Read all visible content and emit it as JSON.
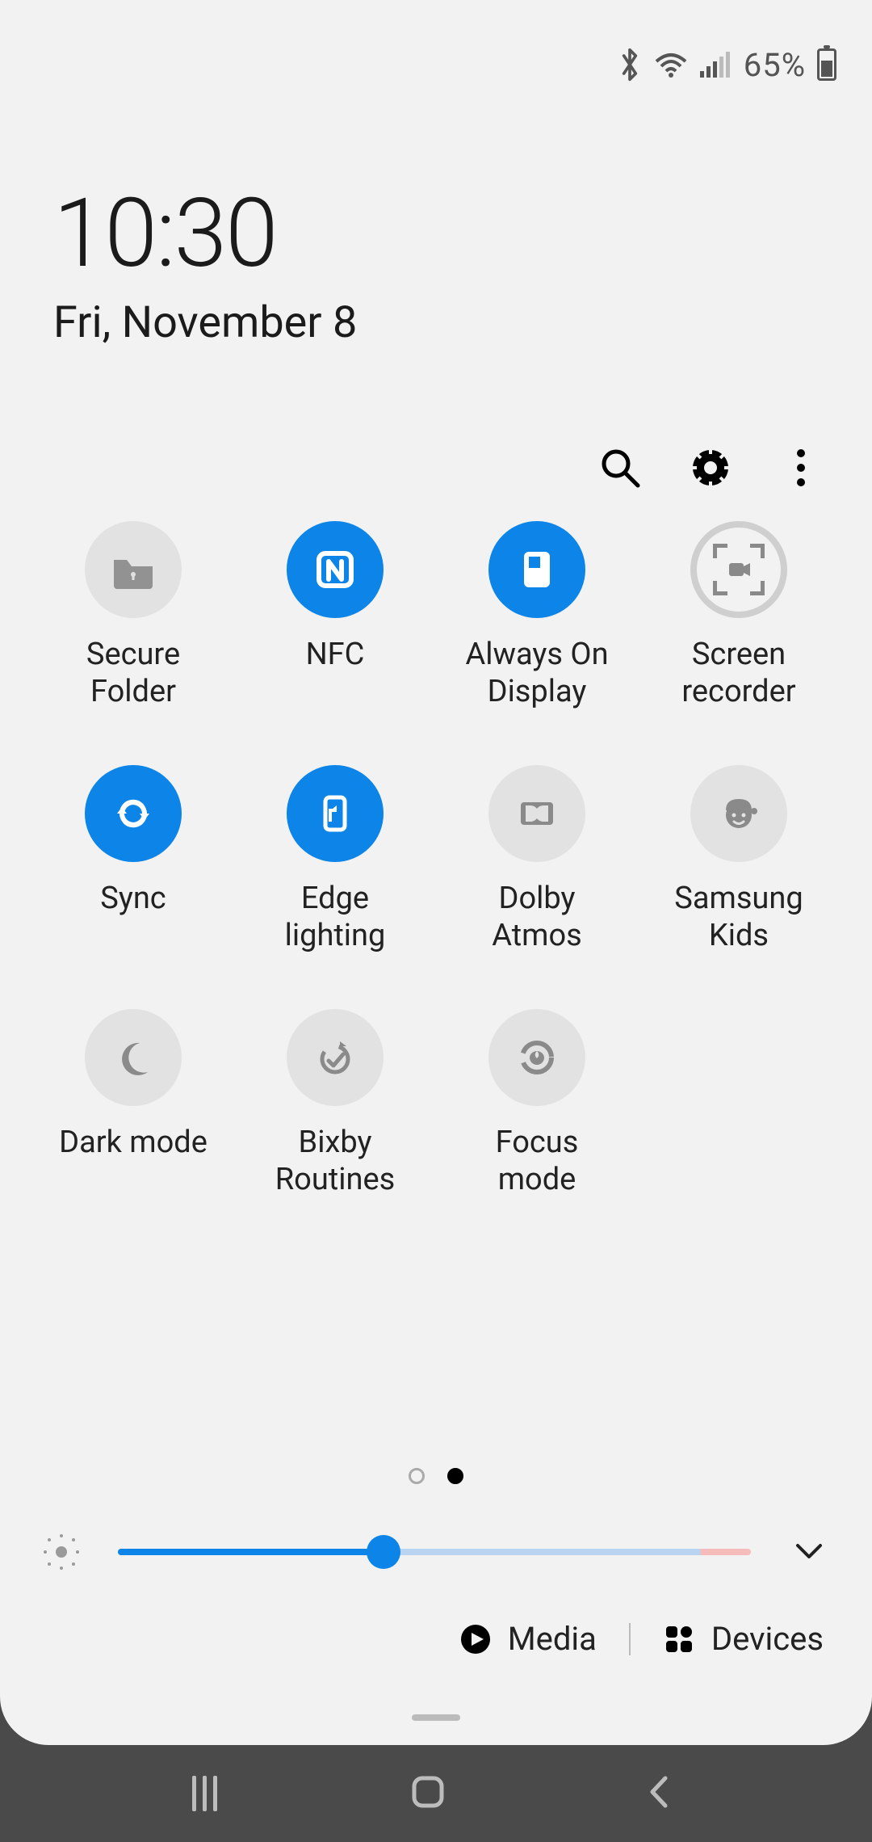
{
  "status": {
    "battery_pct": "65%"
  },
  "datetime": {
    "time": "10:30",
    "date": "Fri, November 8"
  },
  "tiles": [
    {
      "label": "Secure\nFolder",
      "icon": "secure-folder",
      "active": false,
      "outlined": false
    },
    {
      "label": "NFC",
      "icon": "nfc",
      "active": true,
      "outlined": false
    },
    {
      "label": "Always On\nDisplay",
      "icon": "always-on",
      "active": true,
      "outlined": false
    },
    {
      "label": "Screen\nrecorder",
      "icon": "screen-recorder",
      "active": false,
      "outlined": true
    },
    {
      "label": "Sync",
      "icon": "sync",
      "active": true,
      "outlined": false
    },
    {
      "label": "Edge\nlighting",
      "icon": "edge-lighting",
      "active": true,
      "outlined": false
    },
    {
      "label": "Dolby\nAtmos",
      "icon": "dolby",
      "active": false,
      "outlined": false
    },
    {
      "label": "Samsung\nKids",
      "icon": "kids",
      "active": false,
      "outlined": false
    },
    {
      "label": "Dark mode",
      "icon": "dark-mode",
      "active": false,
      "outlined": false
    },
    {
      "label": "Bixby\nRoutines",
      "icon": "bixby",
      "active": false,
      "outlined": false
    },
    {
      "label": "Focus\nmode",
      "icon": "focus",
      "active": false,
      "outlined": false
    }
  ],
  "pages": {
    "count": 2,
    "current": 1
  },
  "brightness_pct": 42,
  "footer": {
    "media_label": "Media",
    "devices_label": "Devices"
  }
}
